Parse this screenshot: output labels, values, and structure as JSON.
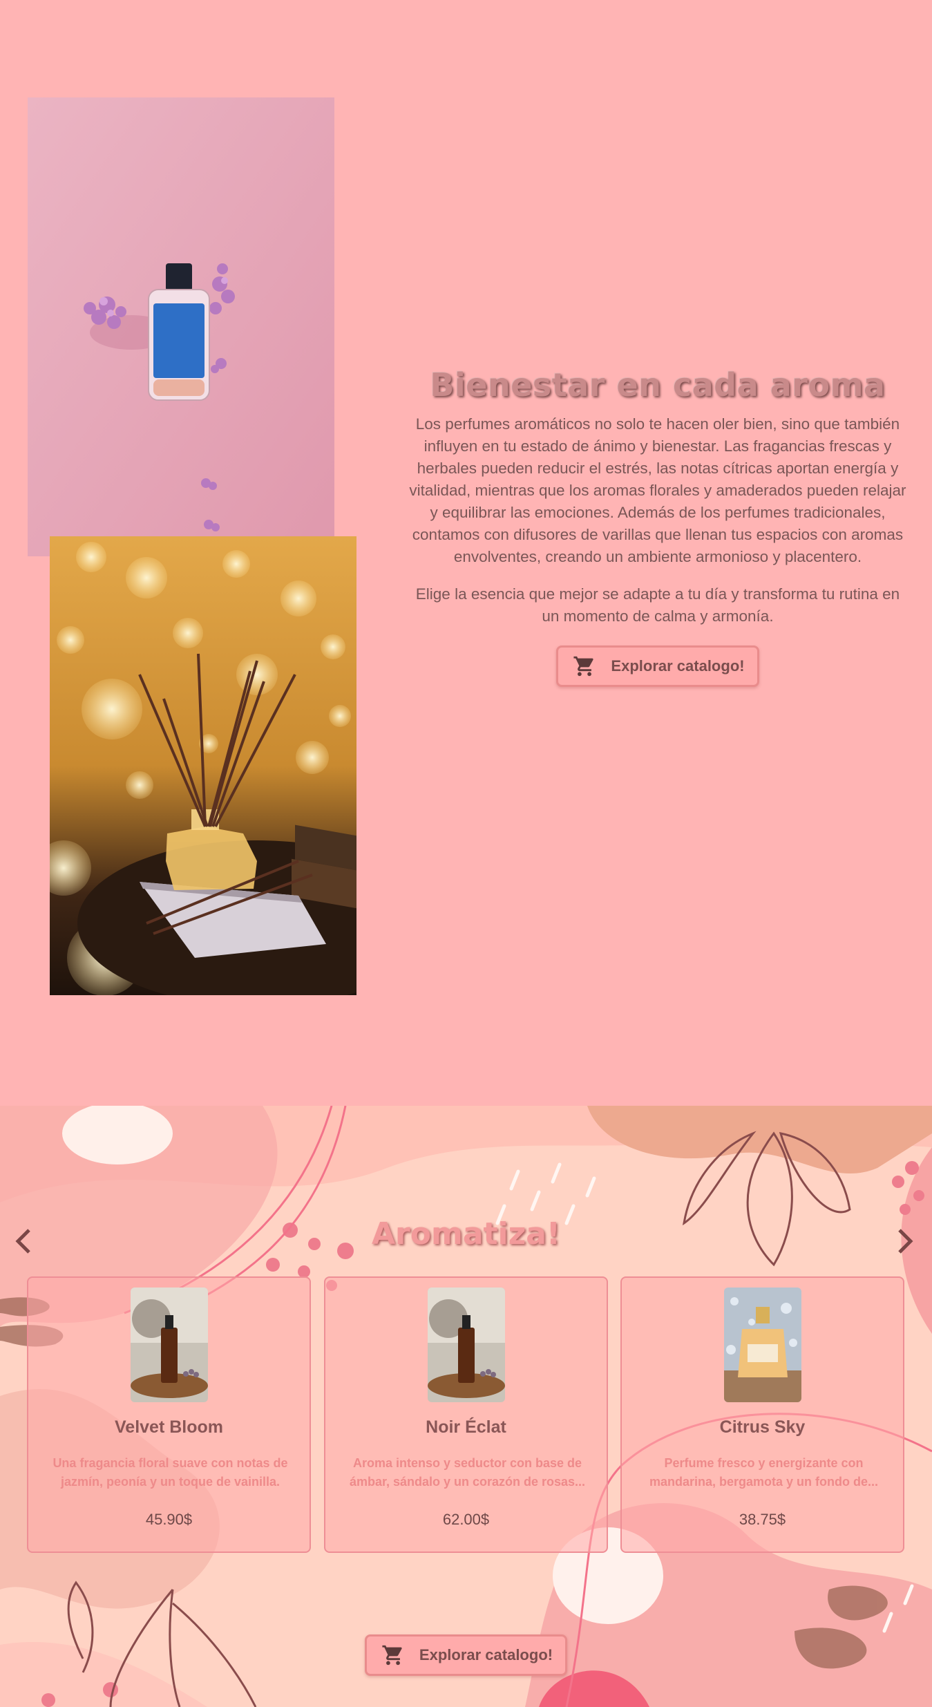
{
  "hero": {
    "title": "Bienestar en cada aroma",
    "paragraph1": "Los perfumes aromáticos no solo te hacen oler bien, sino que también influyen en tu estado de ánimo y bienestar. Las fragancias frescas y herbales pueden reducir el estrés, las notas cítricas aportan energía y vitalidad, mientras que los aromas florales y amaderados pueden relajar y equilibrar las emociones. Además de los perfumes tradicionales, contamos con difusores de varillas que llenan tus espacios con aromas envolventes, creando un ambiente armonioso y placentero.",
    "paragraph2": "Elige la esencia que mejor se adapte a tu día y transforma tu rutina en un momento de calma y armonía.",
    "button_label": "Explorar catalogo!",
    "button_icon": "cart-icon"
  },
  "promo": {
    "title": "Aromatiza!",
    "prev_icon": "chevron-left-icon",
    "next_icon": "chevron-right-icon",
    "products": [
      {
        "name": "Velvet Bloom",
        "description": "Una fragancia floral suave con notas de jazmín, peonía y un toque de vainilla.",
        "price": "45.90$",
        "image_icon": "dropper-bottle-image"
      },
      {
        "name": "Noir Éclat",
        "description": "Aroma intenso y seductor con base de ámbar, sándalo y un corazón de rosas...",
        "price": "62.00$",
        "image_icon": "dropper-bottle-image"
      },
      {
        "name": "Citrus Sky",
        "description": "Perfume fresco y energizante con mandarina, bergamota y un fondo de...",
        "price": "38.75$",
        "image_icon": "perfume-bottle-image"
      }
    ],
    "button_label": "Explorar catalogo!"
  },
  "colors": {
    "hero_background": "#ffb4b4",
    "accent_border": "#e98c8c",
    "title_pink": "#f29a9a",
    "description_pink": "#ee8a8a"
  }
}
